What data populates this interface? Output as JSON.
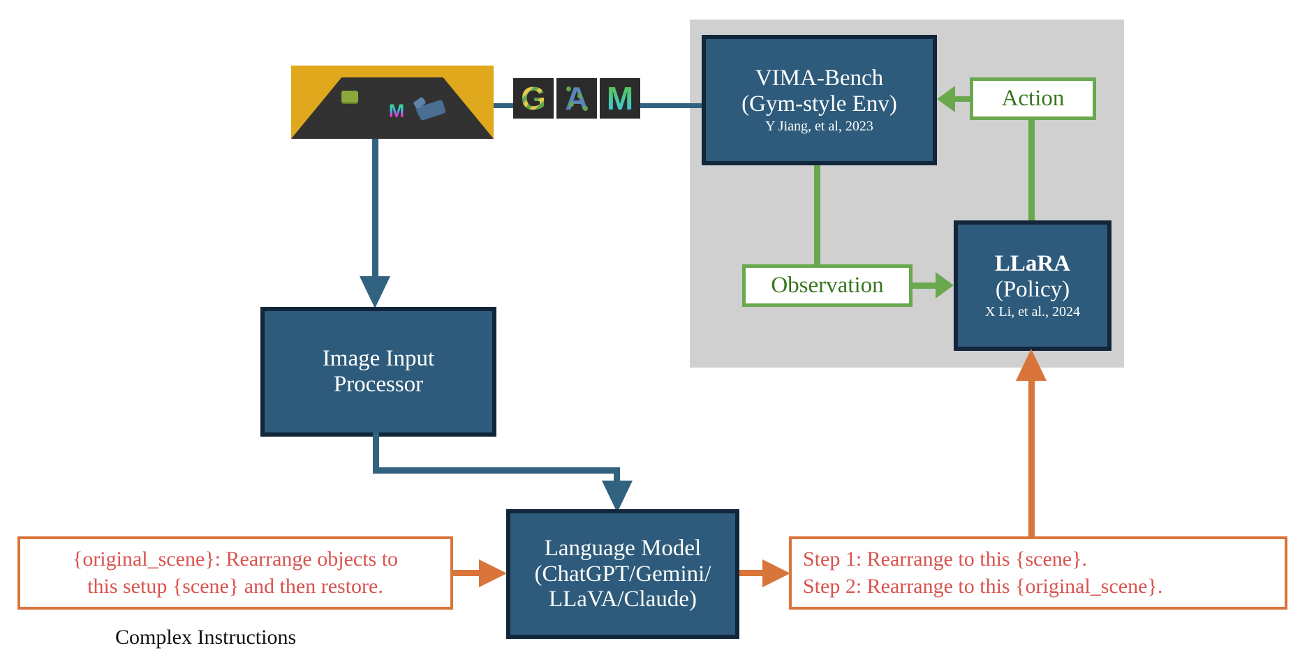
{
  "figure": {
    "title": "LLaRA / VIMA-Bench complex instruction pipeline diagram"
  },
  "colors": {
    "box_fill": "#2e5b7b",
    "box_border": "#11263a",
    "panel_gray": "#d0d0d0",
    "green": "#6aa84f",
    "green_text": "#38761d",
    "orange": "#d9753b",
    "orange_text": "#d9534f",
    "scene_background": "#e0a81c",
    "scene_table": "#323232"
  },
  "scene": {
    "name": "original_scene",
    "objects": [
      {
        "label": "green block",
        "color": "#7ea832"
      },
      {
        "label": "letter M object",
        "color": "#45c0c8"
      },
      {
        "label": "blue tool object",
        "color": "#4a6f92"
      }
    ]
  },
  "tiles": [
    {
      "letter": "G",
      "pattern": "yellow-green-stripes"
    },
    {
      "letter": "A",
      "pattern": "blue-with-green-dots"
    },
    {
      "letter": "M",
      "pattern": "green-cyan-gradient"
    }
  ],
  "boxes": {
    "vima_bench": {
      "line1": "VIMA-Bench",
      "line2": "(Gym-style Env)",
      "citation": "Y Jiang, et al, 2023"
    },
    "llara": {
      "line1": "LLaRA",
      "line2": "(Policy)",
      "citation": "X Li, et al., 2024"
    },
    "image_input_processor": {
      "line1": "Image Input",
      "line2": "Processor"
    },
    "language_model": {
      "line1": "Language Model",
      "line2": "(ChatGPT/Gemini/",
      "line3": "LLaVA/Claude)"
    }
  },
  "labels": {
    "action": "Action",
    "observation": "Observation",
    "complex_instructions": "Complex Instructions"
  },
  "instruction_box": {
    "line1": "{original_scene}: Rearrange objects to",
    "line2": "this setup {scene} and then restore."
  },
  "steps_box": {
    "line1": "Step 1: Rearrange to this {scene}.",
    "line2": "Step 2: Rearrange to this {original_scene}."
  }
}
